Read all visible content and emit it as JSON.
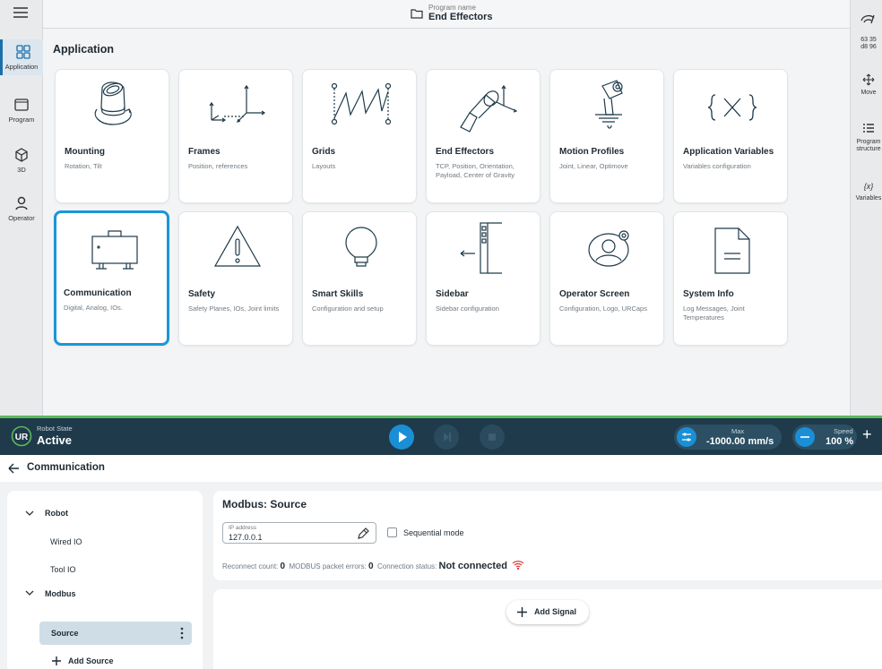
{
  "nav": {
    "items": [
      {
        "label": "Application",
        "icon": "grid-icon",
        "active": true
      },
      {
        "label": "Program",
        "icon": "program-icon",
        "active": false
      },
      {
        "label": "3D",
        "icon": "cube-icon",
        "active": false
      },
      {
        "label": "Operator",
        "icon": "person-icon",
        "active": false
      }
    ]
  },
  "header": {
    "program_label": "Program name",
    "program_name": "End Effectors"
  },
  "right_panel": {
    "code": "63 35\nd8 96",
    "items": [
      {
        "label": "Move",
        "icon": "move-icon"
      },
      {
        "label": "Program structure",
        "icon": "list-icon"
      },
      {
        "label": "Variables",
        "icon": "variables-icon"
      }
    ]
  },
  "application": {
    "title": "Application",
    "cards": [
      {
        "title": "Mounting",
        "desc": "Rotation, Tilt",
        "icon": "mounting-icon"
      },
      {
        "title": "Frames",
        "desc": "Position, references",
        "icon": "frames-icon"
      },
      {
        "title": "Grids",
        "desc": "Layouts",
        "icon": "grids-icon"
      },
      {
        "title": "End Effectors",
        "desc": "TCP, Position, Orientation, Payload, Center of Gravity",
        "icon": "end-effector-icon"
      },
      {
        "title": "Motion Profiles",
        "desc": "Joint, Linear, Optimove",
        "icon": "motion-icon"
      },
      {
        "title": "Application Variables",
        "desc": "Variables configuration",
        "icon": "variables-icon"
      },
      {
        "title": "Communication",
        "desc": "Digital, Analog, IOs.",
        "icon": "communication-icon",
        "selected": true
      },
      {
        "title": "Safety",
        "desc": "Safety Planes, IOs, Joint limits",
        "icon": "warning-icon"
      },
      {
        "title": "Smart Skills",
        "desc": "Configuration and setup",
        "icon": "lightbulb-icon"
      },
      {
        "title": "Sidebar",
        "desc": "Sidebar configuration",
        "icon": "sidebar-icon"
      },
      {
        "title": "Operator Screen",
        "desc": "Configuration, Logo, URCaps",
        "icon": "operator-icon"
      },
      {
        "title": "System Info",
        "desc": "Log Messages, Joint Temperatures",
        "icon": "document-icon"
      }
    ]
  },
  "status": {
    "robot_state_label": "Robot State",
    "robot_state_value": "Active",
    "max_label": "Max",
    "max_value": "-1000.00 mm/s",
    "speed_label": "Speed",
    "speed_value": "100 %",
    "plus": "+",
    "colors": {
      "bar": "#1f3a4a",
      "accent": "#5cb85c",
      "play": "#1a8fd6"
    }
  },
  "communication": {
    "title": "Communication",
    "tree": {
      "robot": "Robot",
      "wired_io": "Wired IO",
      "tool_io": "Tool IO",
      "modbus": "Modbus",
      "source": "Source",
      "add_source": "Add Source"
    },
    "detail": {
      "title": "Modbus: Source",
      "ip_label": "IP address",
      "ip_value": "127.0.0.1",
      "sequential_mode": "Sequential mode",
      "reconnect_label": "Reconnect count:",
      "reconnect_value": "0",
      "errors_label": "MODBUS packet errors:",
      "errors_value": "0",
      "conn_label": "Connection status:",
      "conn_value": "Not connected"
    },
    "add_signal": "Add Signal"
  }
}
